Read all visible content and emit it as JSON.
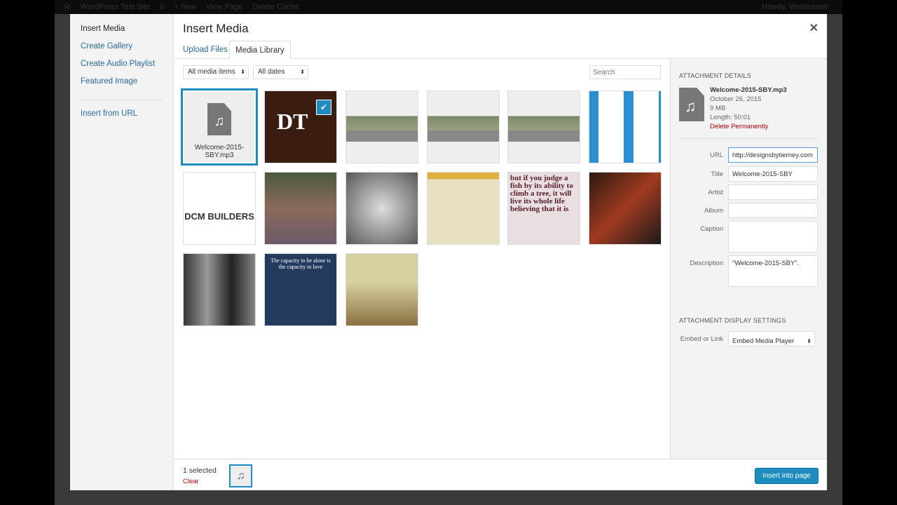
{
  "adminbar": {
    "site": "WordPress Test Site",
    "comments": "0",
    "new": "+ New",
    "view": "View Page",
    "cache": "Delete Cache",
    "howdy": "Howdy, Webmaster"
  },
  "menu": {
    "items": [
      "Insert Media",
      "Create Gallery",
      "Create Audio Playlist",
      "Featured Image"
    ],
    "url": "Insert from URL"
  },
  "title": "Insert Media",
  "tabs": [
    "Upload Files",
    "Media Library"
  ],
  "filters": {
    "type": "All media items",
    "date": "All dates",
    "search_placeholder": "Search"
  },
  "grid": [
    {
      "kind": "audio",
      "label": "Welcome-2015-SBY.mp3",
      "selected": true
    },
    {
      "kind": "logo",
      "text": "DT"
    },
    {
      "kind": "street"
    },
    {
      "kind": "street"
    },
    {
      "kind": "street"
    },
    {
      "kind": "phone"
    },
    {
      "kind": "builder",
      "text": "DCM BUILDERS"
    },
    {
      "kind": "family"
    },
    {
      "kind": "note"
    },
    {
      "kind": "doc"
    },
    {
      "kind": "quote",
      "text": "but if you judge a fish by its ability to climb a tree, it will live its whole life believing that it is"
    },
    {
      "kind": "devices"
    },
    {
      "kind": "bw"
    },
    {
      "kind": "bluequote",
      "text": "The capacity to be alone is the capacity to love"
    },
    {
      "kind": "sheep"
    }
  ],
  "details": {
    "heading": "Attachment Details",
    "filename": "Welcome-2015-SBY.mp3",
    "date": "October 26, 2015",
    "size": "9 MB",
    "length": "Length: 50:01",
    "delete": "Delete Permanently",
    "fields": [
      {
        "label": "URL",
        "value": "http://designsbytierney.com"
      },
      {
        "label": "Title",
        "value": "Welcome-2015-SBY"
      },
      {
        "label": "Artist",
        "value": ""
      },
      {
        "label": "Album",
        "value": ""
      },
      {
        "label": "Caption",
        "value": ""
      },
      {
        "label": "Description",
        "value": "\"Welcome-2015-SBY\"."
      }
    ],
    "display_heading": "Attachment Display Settings",
    "embed_label": "Embed or Link",
    "embed_value": "Embed Media Player"
  },
  "footer": {
    "count": "1 selected",
    "clear": "Clear",
    "insert": "Insert into page"
  },
  "colors": {
    "accent": "#1e8cbe",
    "delete": "#a00"
  }
}
